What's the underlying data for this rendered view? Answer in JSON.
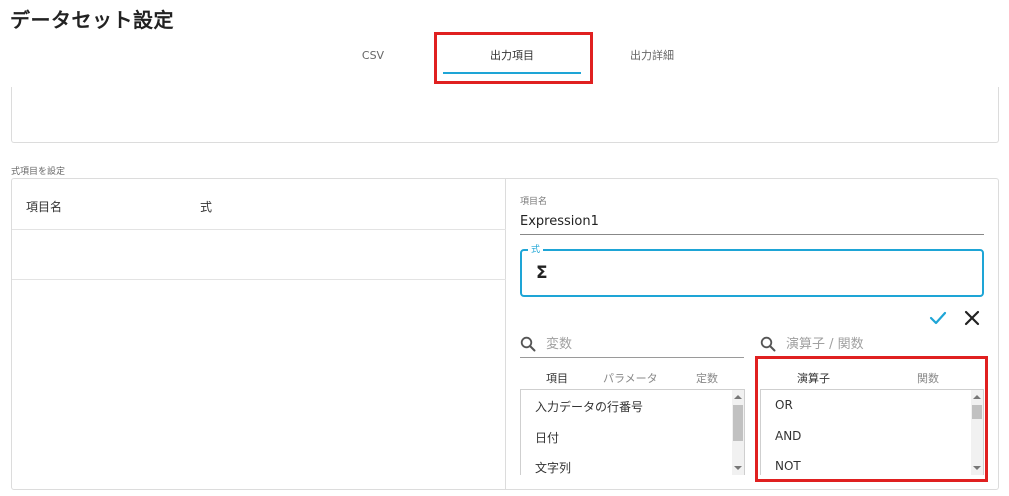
{
  "page": {
    "title": "データセット設定"
  },
  "tabs": [
    {
      "label": "CSV"
    },
    {
      "label": "出力項目"
    },
    {
      "label": "出力詳細"
    }
  ],
  "formula_section": {
    "label": "式項目を設定"
  },
  "table": {
    "headers": [
      "項目名",
      "式"
    ]
  },
  "editor": {
    "name_label": "項目名",
    "name_value": "Expression1",
    "expr_label": "式",
    "expr_value": "Σ"
  },
  "variables": {
    "search_placeholder": "変数",
    "tabs": [
      "項目",
      "パラメータ",
      "定数"
    ],
    "items": [
      "入力データの行番号",
      "日付",
      "文字列"
    ]
  },
  "operators": {
    "search_placeholder": "演算子 / 関数",
    "tabs": [
      "演算子",
      "関数"
    ],
    "items": [
      "OR",
      "AND",
      "NOT"
    ]
  },
  "colors": {
    "accent": "#1ea5d6",
    "highlight": "#e02020"
  },
  "icons": {
    "confirm": "check-icon",
    "cancel": "close-icon",
    "search": "search-icon"
  }
}
